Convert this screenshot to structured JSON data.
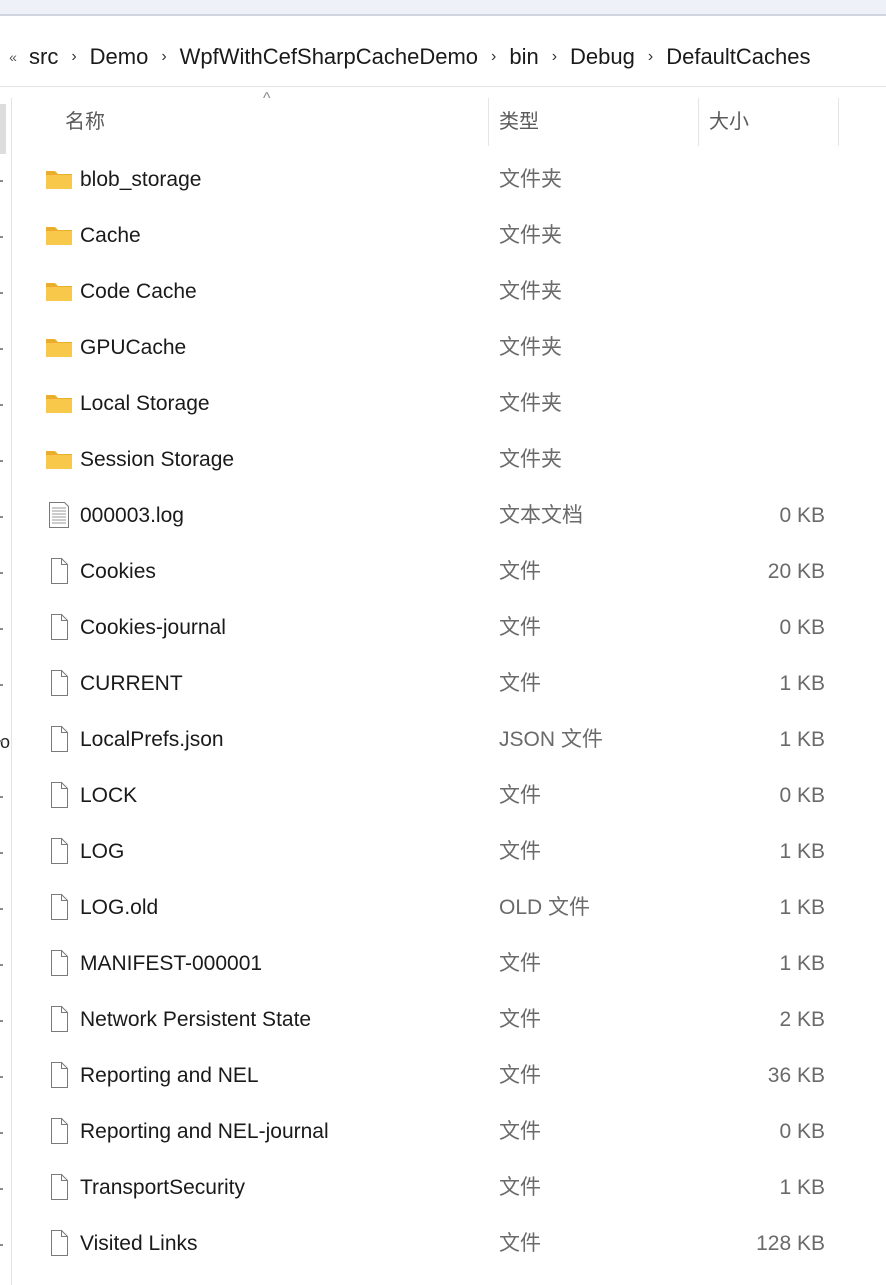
{
  "breadcrumb": {
    "overflow": "«",
    "items": [
      "src",
      "Demo",
      "WpfWithCefSharpCacheDemo",
      "bin",
      "Debug",
      "DefaultCaches"
    ],
    "separator": "›"
  },
  "columns": {
    "name": "名称",
    "type": "类型",
    "size": "大小",
    "sort_indicator": "^"
  },
  "left_pane_char": "o",
  "files": [
    {
      "name": "blob_storage",
      "type": "文件夹",
      "size": "",
      "icon": "folder-icon"
    },
    {
      "name": "Cache",
      "type": "文件夹",
      "size": "",
      "icon": "folder-icon"
    },
    {
      "name": "Code Cache",
      "type": "文件夹",
      "size": "",
      "icon": "folder-icon"
    },
    {
      "name": "GPUCache",
      "type": "文件夹",
      "size": "",
      "icon": "folder-icon"
    },
    {
      "name": "Local Storage",
      "type": "文件夹",
      "size": "",
      "icon": "folder-icon"
    },
    {
      "name": "Session Storage",
      "type": "文件夹",
      "size": "",
      "icon": "folder-icon"
    },
    {
      "name": "000003.log",
      "type": "文本文档",
      "size": "0 KB",
      "icon": "text-document-icon"
    },
    {
      "name": "Cookies",
      "type": "文件",
      "size": "20 KB",
      "icon": "file-icon"
    },
    {
      "name": "Cookies-journal",
      "type": "文件",
      "size": "0 KB",
      "icon": "file-icon"
    },
    {
      "name": "CURRENT",
      "type": "文件",
      "size": "1 KB",
      "icon": "file-icon"
    },
    {
      "name": "LocalPrefs.json",
      "type": "JSON 文件",
      "size": "1 KB",
      "icon": "file-icon"
    },
    {
      "name": "LOCK",
      "type": "文件",
      "size": "0 KB",
      "icon": "file-icon"
    },
    {
      "name": "LOG",
      "type": "文件",
      "size": "1 KB",
      "icon": "file-icon"
    },
    {
      "name": "LOG.old",
      "type": "OLD 文件",
      "size": "1 KB",
      "icon": "file-icon"
    },
    {
      "name": "MANIFEST-000001",
      "type": "文件",
      "size": "1 KB",
      "icon": "file-icon"
    },
    {
      "name": "Network Persistent State",
      "type": "文件",
      "size": "2 KB",
      "icon": "file-icon"
    },
    {
      "name": "Reporting and NEL",
      "type": "文件",
      "size": "36 KB",
      "icon": "file-icon"
    },
    {
      "name": "Reporting and NEL-journal",
      "type": "文件",
      "size": "0 KB",
      "icon": "file-icon"
    },
    {
      "name": "TransportSecurity",
      "type": "文件",
      "size": "1 KB",
      "icon": "file-icon"
    },
    {
      "name": "Visited Links",
      "type": "文件",
      "size": "128 KB",
      "icon": "file-icon"
    }
  ],
  "colors": {
    "folder": "#f8c84a",
    "folder_dark": "#e8ae2c",
    "file_border": "#7a7a7a"
  }
}
